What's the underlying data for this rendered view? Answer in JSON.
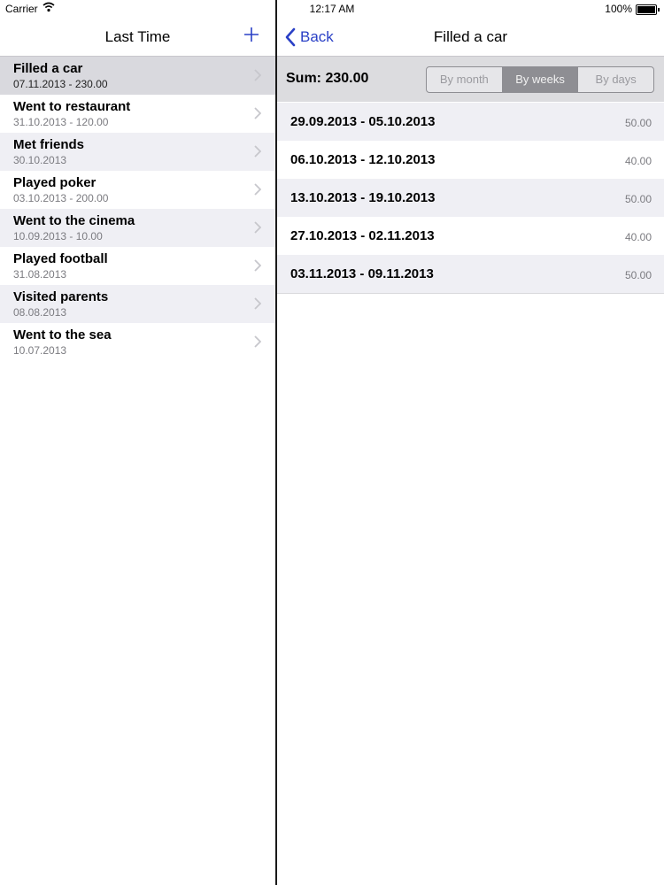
{
  "status_bar": {
    "carrier": "Carrier",
    "time": "12:17 AM",
    "battery": "100%"
  },
  "master": {
    "title": "Last Time",
    "add_icon": "plus-icon",
    "items": [
      {
        "title": "Filled a car",
        "subtitle": "07.11.2013 - 230.00",
        "selected": true
      },
      {
        "title": "Went to restaurant",
        "subtitle": "31.10.2013 - 120.00"
      },
      {
        "title": "Met friends",
        "subtitle": "30.10.2013"
      },
      {
        "title": "Played poker",
        "subtitle": "03.10.2013 - 200.00"
      },
      {
        "title": "Went to the cinema",
        "subtitle": "10.09.2013 - 10.00"
      },
      {
        "title": "Played football",
        "subtitle": "31.08.2013"
      },
      {
        "title": "Visited parents",
        "subtitle": "08.08.2013"
      },
      {
        "title": "Went to the sea",
        "subtitle": "10.07.2013"
      }
    ]
  },
  "detail": {
    "back_label": "Back",
    "title": "Filled a car",
    "sum": "Sum: 230.00",
    "segments": [
      "By month",
      "By weeks",
      "By days"
    ],
    "active_segment": "By weeks",
    "weeks": [
      {
        "range": "29.09.2013 - 05.10.2013",
        "amount": "50.00"
      },
      {
        "range": "06.10.2013 - 12.10.2013",
        "amount": "40.00"
      },
      {
        "range": "13.10.2013 - 19.10.2013",
        "amount": "50.00"
      },
      {
        "range": "27.10.2013 - 02.11.2013",
        "amount": "40.00"
      },
      {
        "range": "03.11.2013 - 09.11.2013",
        "amount": "50.00"
      }
    ]
  },
  "colors": {
    "accent": "#2a40c6",
    "selected_row": "#d9d9de",
    "alt_row": "#efeff4",
    "segment_active": "#8e8e93"
  }
}
